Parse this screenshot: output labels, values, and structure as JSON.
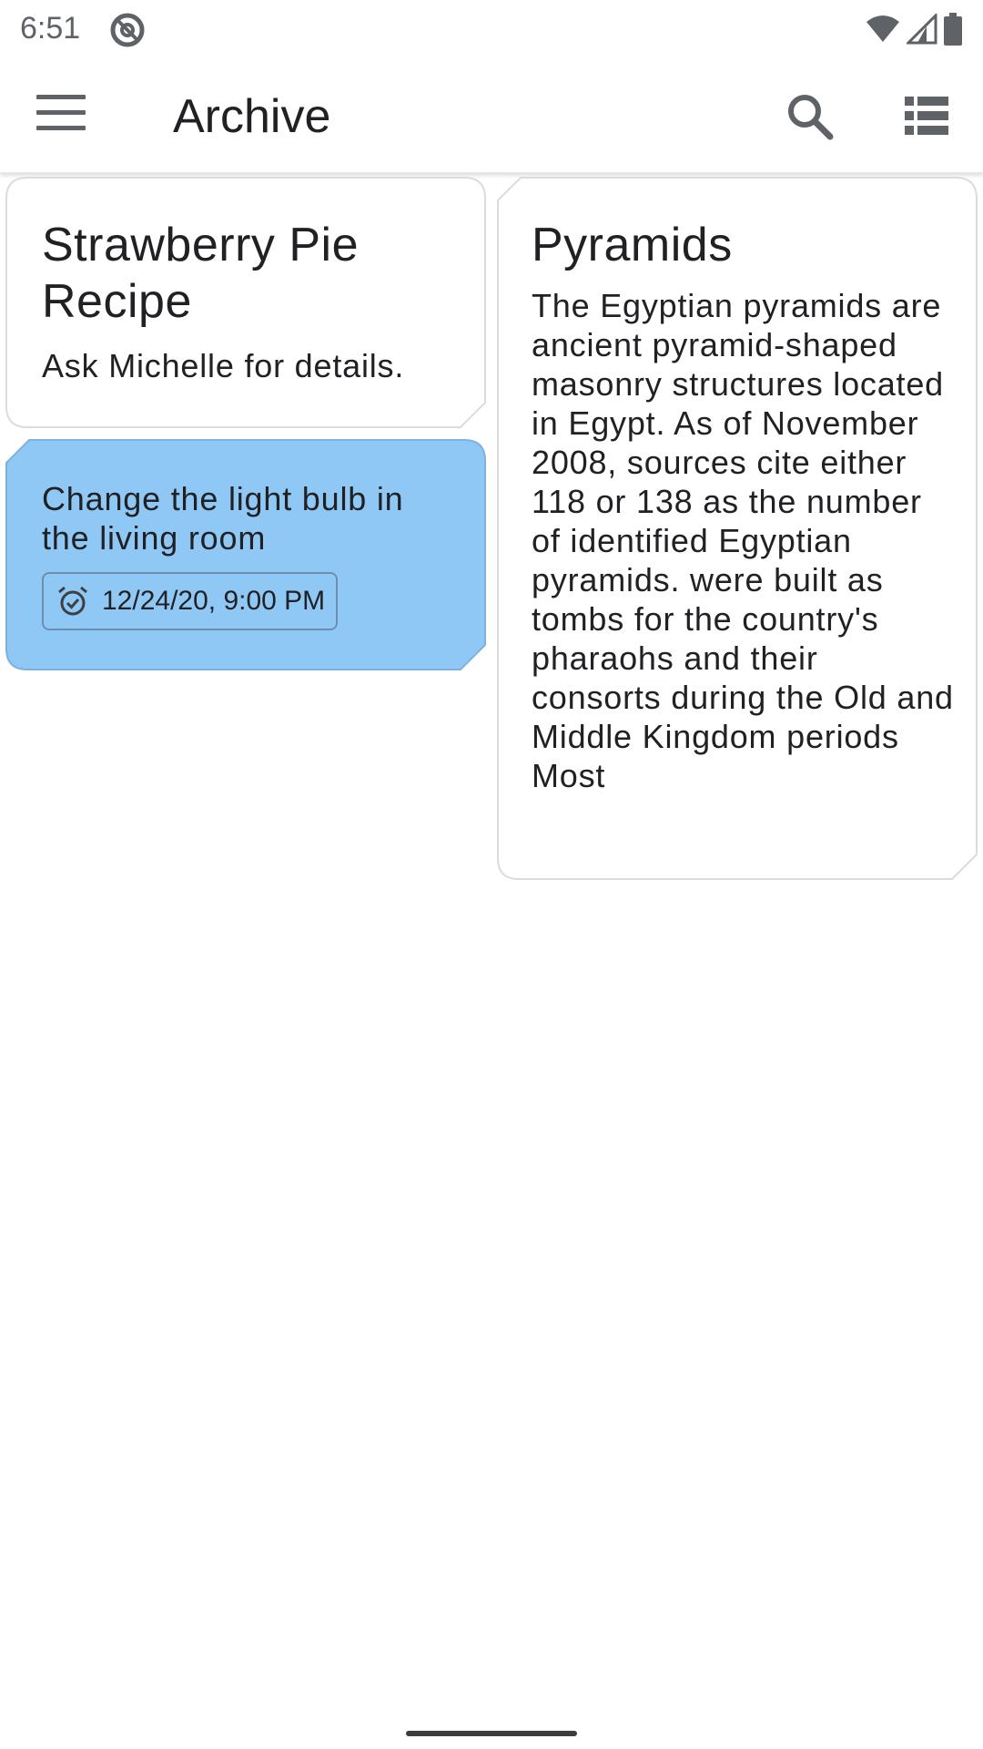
{
  "status_bar": {
    "time": "6:51",
    "icons": [
      "dnd-icon",
      "wifi-icon",
      "signal-icon",
      "battery-icon"
    ]
  },
  "app_bar": {
    "title": "Archive",
    "icons": [
      "menu-icon",
      "search-icon",
      "list-view-icon"
    ]
  },
  "notes": [
    {
      "title": "Strawberry Pie Recipe",
      "body": "Ask Michelle for details.",
      "color": "#ffffff"
    },
    {
      "title": "",
      "body": "Change the light bulb in the living room",
      "reminder": "12/24/20, 9:00 PM",
      "color": "#90c8f5"
    },
    {
      "title": "Pyramids",
      "body": "The Egyptian pyramids are ancient pyramid-shaped masonry structures located in Egypt. As of November 2008, sources cite either 118 or 138 as the number of identified Egyptian pyramids. were built as tombs for the country's pharaohs and their consorts during the Old and Middle Kingdom periods Most",
      "color": "#ffffff"
    }
  ],
  "colors": {
    "accent_blue": "#90c8f5",
    "border": "#dadce0",
    "icon_grey": "#5f6368"
  }
}
